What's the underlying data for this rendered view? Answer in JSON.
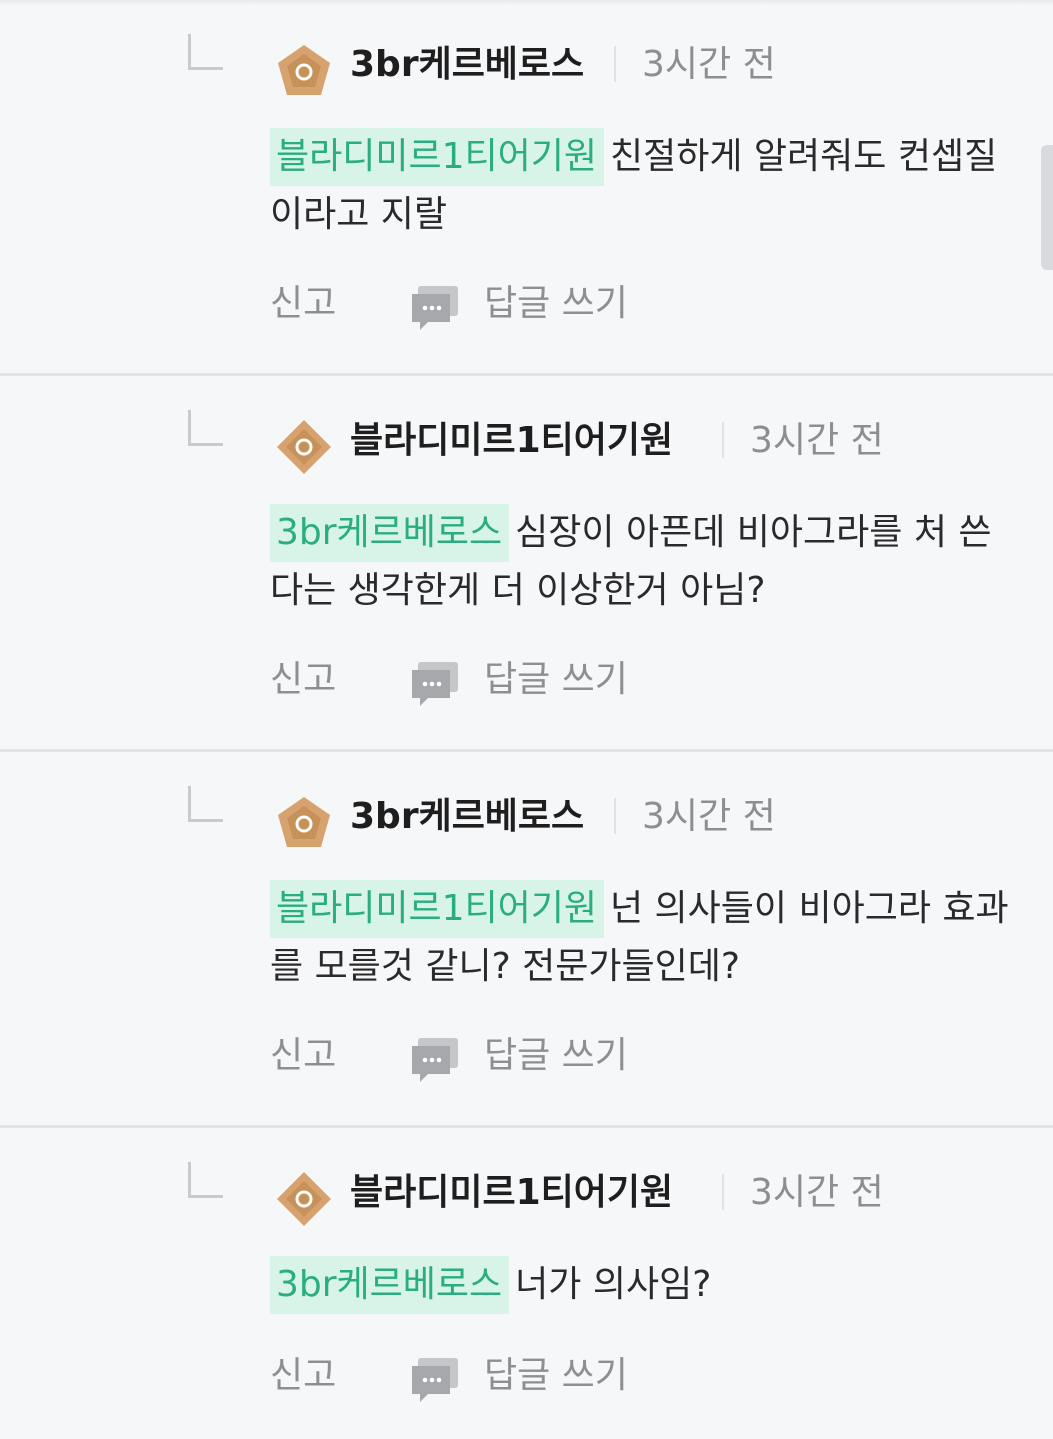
{
  "comments": [
    {
      "author": "3br케르베로스",
      "time": "3시간 전",
      "rank_icon": "pentagon-rank-icon",
      "mention": "블라디미르1티어기원",
      "text": "친절하게 알려줘도 컨셉질이라고 지랄",
      "report_label": "신고",
      "reply_label": "답글 쓰기"
    },
    {
      "author": "블라디미르1티어기원",
      "time": "3시간 전",
      "rank_icon": "diamond-rank-icon",
      "mention": "3br케르베로스",
      "text": "심장이 아픈데 비아그라를 처 쓴다는 생각한게 더 이상한거 아님?",
      "report_label": "신고",
      "reply_label": "답글 쓰기"
    },
    {
      "author": "3br케르베로스",
      "time": "3시간 전",
      "rank_icon": "pentagon-rank-icon",
      "mention": "블라디미르1티어기원",
      "text": "넌 의사들이 비아그라 효과를 모를것 같니? 전문가들인데?",
      "report_label": "신고",
      "reply_label": "답글 쓰기"
    },
    {
      "author": "블라디미르1티어기원",
      "time": "3시간 전",
      "rank_icon": "diamond-rank-icon",
      "mention": "3br케르베로스",
      "text": "너가 의사임?",
      "report_label": "신고",
      "reply_label": "답글 쓰기"
    }
  ],
  "colors": {
    "background": "#f6f7f9",
    "mention_bg": "#d8f3e7",
    "mention_text": "#2aae7d",
    "rank_badge": "#d6a36e",
    "muted_text": "#8e8f93"
  }
}
